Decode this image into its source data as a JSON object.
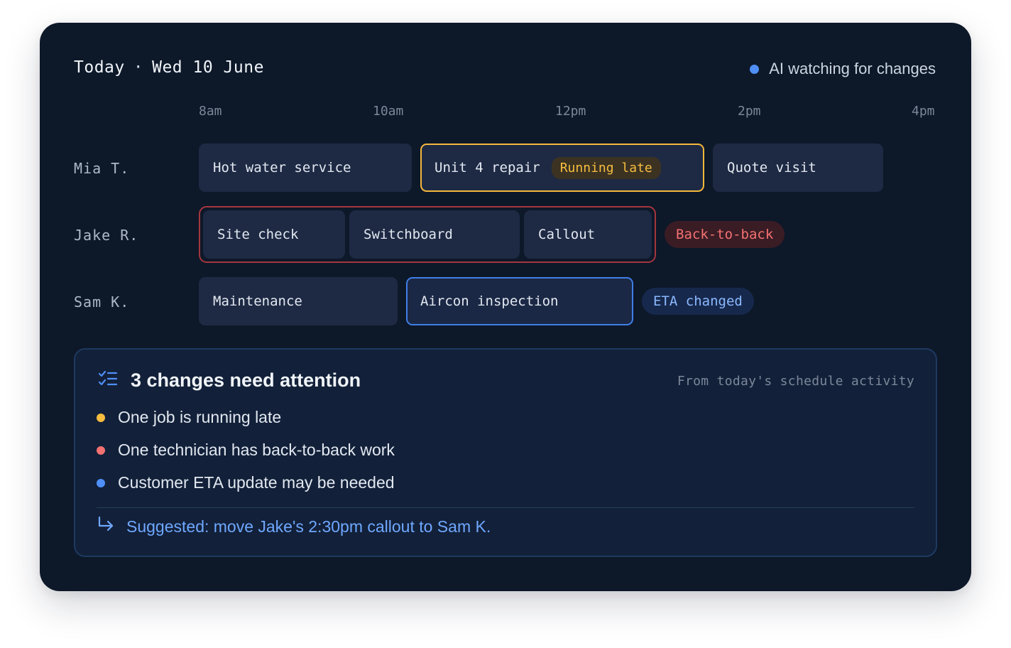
{
  "header": {
    "today_label": "Today",
    "separator": "·",
    "date": "Wed 10 June",
    "ai_status": "AI watching for changes"
  },
  "timeline": {
    "hours": [
      "8am",
      "10am",
      "12pm",
      "2pm",
      "4pm"
    ]
  },
  "technicians": [
    {
      "name": "Mia T.",
      "jobs": [
        {
          "label": "Hot water service"
        },
        {
          "label": "Unit 4 repair",
          "badge": "Running late"
        },
        {
          "label": "Quote visit"
        }
      ]
    },
    {
      "name": "Jake R.",
      "jobs": [
        {
          "label": "Site check"
        },
        {
          "label": "Switchboard"
        },
        {
          "label": "Callout"
        }
      ],
      "badge": "Back-to-back"
    },
    {
      "name": "Sam K.",
      "jobs": [
        {
          "label": "Maintenance"
        },
        {
          "label": "Aircon inspection"
        }
      ],
      "badge": "ETA changed"
    }
  ],
  "attention": {
    "title": "3 changes need attention",
    "source": "From today's schedule activity",
    "items": [
      {
        "text": "One job is running late",
        "color": "#f6bd3f"
      },
      {
        "text": "One technician has back-to-back work",
        "color": "#f37171"
      },
      {
        "text": "Customer ETA update may be needed",
        "color": "#4f8ff7"
      }
    ],
    "suggestion": "Suggested: move Jake's 2:30pm callout to Sam K."
  },
  "icons": {
    "status": "status-dot-icon",
    "checklist": "checklist-icon",
    "suggestion": "arrow-return-icon"
  },
  "colors": {
    "background": "#0d1829",
    "late": "#f5b83b",
    "back_to_back": "#a5363d",
    "eta": "#3f7fe6"
  }
}
